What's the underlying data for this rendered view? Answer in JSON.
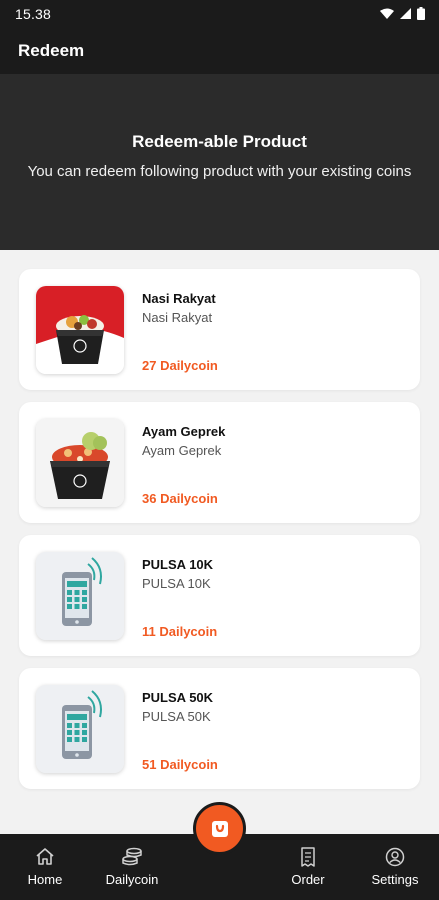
{
  "status_bar": {
    "time": "15.38"
  },
  "app_bar": {
    "title": "Redeem"
  },
  "hero": {
    "title": "Redeem-able Product",
    "subtitle": "You can redeem following product with your existing coins"
  },
  "products": [
    {
      "name": "Nasi Rakyat",
      "subtitle": "Nasi Rakyat",
      "price": "27 Dailycoin",
      "image": "food-box-rice"
    },
    {
      "name": "Ayam Geprek",
      "subtitle": "Ayam Geprek",
      "price": "36 Dailycoin",
      "image": "food-box-chicken"
    },
    {
      "name": "PULSA 10K",
      "subtitle": "PULSA 10K",
      "price": "11 Dailycoin",
      "image": "phone-credit"
    },
    {
      "name": "PULSA 50K",
      "subtitle": "PULSA 50K",
      "price": "51 Dailycoin",
      "image": "phone-credit"
    }
  ],
  "bottom_nav": {
    "items": [
      {
        "label": "Home",
        "icon": "home-icon"
      },
      {
        "label": "Dailycoin",
        "icon": "coins-icon"
      },
      {
        "label": "Order",
        "icon": "receipt-icon"
      },
      {
        "label": "Settings",
        "icon": "user-icon"
      }
    ],
    "center_icon": "shopping-bag-icon"
  },
  "colors": {
    "accent": "#f15a22",
    "dark": "#1b1b1b",
    "hero": "#2b2b2b",
    "background": "#f2f2f2"
  }
}
